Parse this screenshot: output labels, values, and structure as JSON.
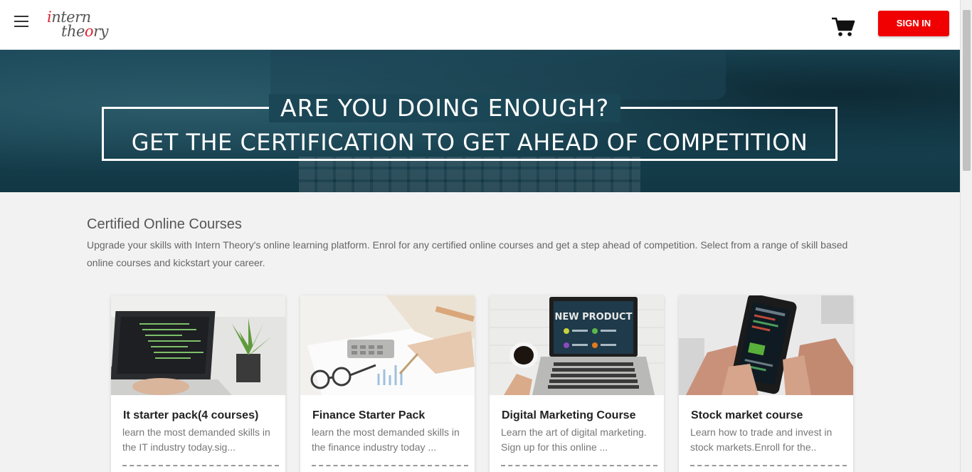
{
  "header": {
    "logo_line1_first": "i",
    "logo_line1_rest": "ntern",
    "logo_line2_start": "the",
    "logo_line2_q": "o",
    "logo_line2_end": "ry",
    "signin_label": "SIGN IN",
    "brand_color": "#f00000"
  },
  "banner": {
    "line1": "ARE YOU DOING ENOUGH?",
    "line2": "GET THE CERTIFICATION TO GET AHEAD OF COMPETITION"
  },
  "section": {
    "title": "Certified Online Courses",
    "description": "Upgrade your skills with Intern Theory's online learning platform. Enrol for any certified online courses and get a step ahead of competition. Select from a range of skill based online courses and kickstart your career."
  },
  "courses": [
    {
      "title": "It starter pack(4 courses)",
      "description": "learn the most demanded skills in the IT industry today.sig..."
    },
    {
      "title": "Finance Starter Pack",
      "description": "learn the most demanded skills in the finance industry today ..."
    },
    {
      "title": "Digital Marketing Course",
      "description": "Learn the art of digital marketing. Sign up for this online ...",
      "image_text": "NEW PRODUCT"
    },
    {
      "title": "Stock market course",
      "description": "Learn how to trade and invest in stock markets.Enroll for the.."
    }
  ]
}
